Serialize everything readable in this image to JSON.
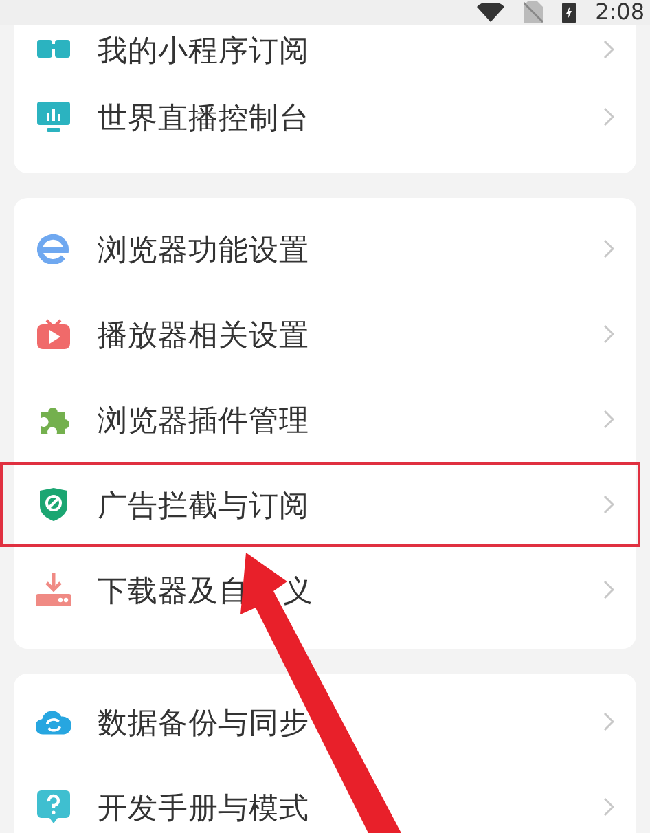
{
  "status_bar": {
    "time": "2:08"
  },
  "groups": [
    {
      "items": [
        {
          "label": "我的小程序订阅",
          "highlighted": false
        },
        {
          "label": "世界直播控制台",
          "highlighted": false
        }
      ]
    },
    {
      "items": [
        {
          "label": "浏览器功能设置",
          "highlighted": false
        },
        {
          "label": "播放器相关设置",
          "highlighted": false
        },
        {
          "label": "浏览器插件管理",
          "highlighted": false
        },
        {
          "label": "广告拦截与订阅",
          "highlighted": true
        },
        {
          "label_parts": [
            "下载器及自",
            "义"
          ],
          "highlighted": false
        }
      ]
    },
    {
      "items": [
        {
          "label": "数据备份与同步",
          "highlighted": false
        },
        {
          "label": "开发手册与模式",
          "highlighted": false
        }
      ]
    }
  ]
}
